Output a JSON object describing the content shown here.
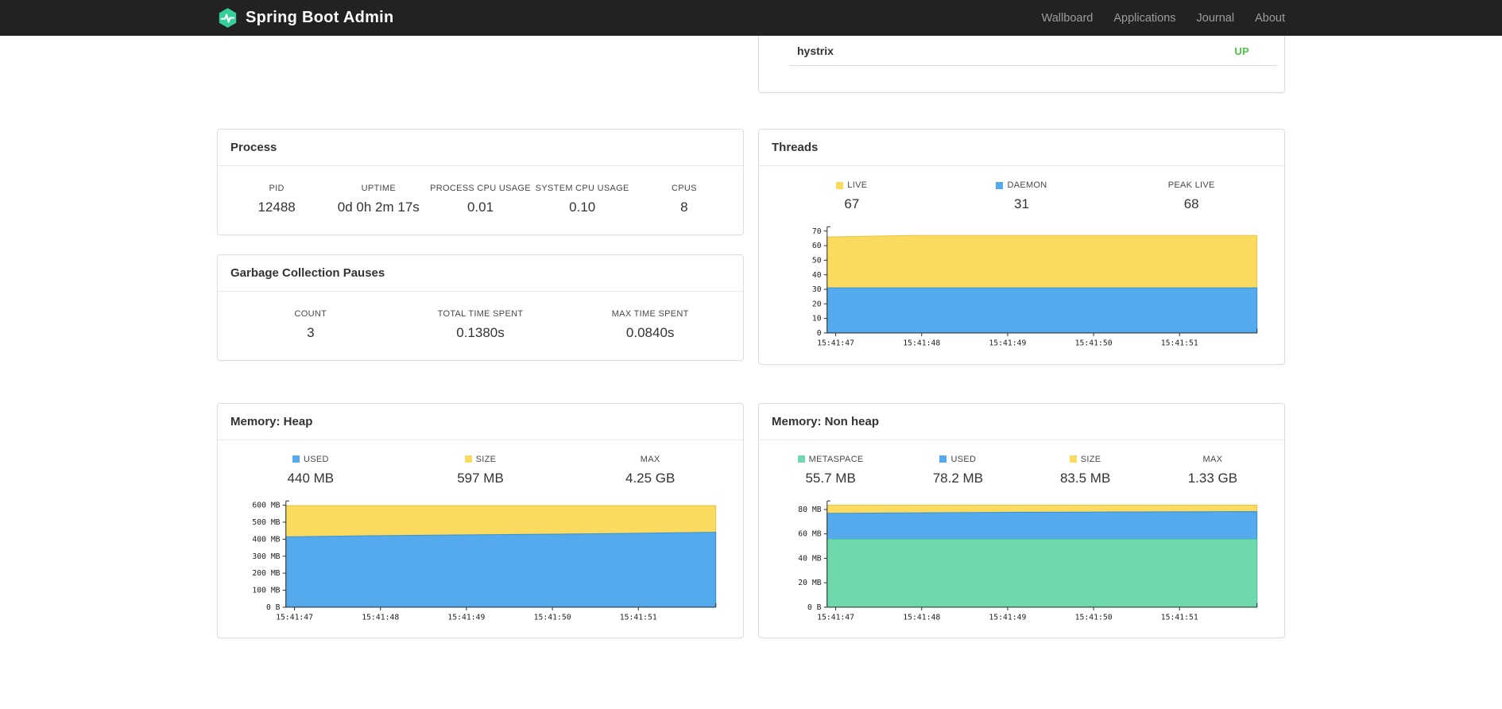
{
  "navbar": {
    "brand": "Spring Boot Admin",
    "items": [
      "Wallboard",
      "Applications",
      "Journal",
      "About"
    ]
  },
  "colors": {
    "navbar_bg": "#222222",
    "logo_green": "#36cf9a",
    "status_up": "#4ec04e",
    "chart_yellow": "#fbda60",
    "chart_blue": "#54aaec",
    "chart_green": "#6fd9ad"
  },
  "application_panel": {
    "row_label": "hystrix",
    "row_status": "UP"
  },
  "panels": {
    "process": {
      "title": "Process",
      "metrics": [
        {
          "label": "PID",
          "value": "12488"
        },
        {
          "label": "UPTIME",
          "value": "0d 0h 2m 17s"
        },
        {
          "label": "PROCESS CPU USAGE",
          "value": "0.01"
        },
        {
          "label": "SYSTEM CPU USAGE",
          "value": "0.10"
        },
        {
          "label": "CPUS",
          "value": "8"
        }
      ]
    },
    "gc": {
      "title": "Garbage Collection Pauses",
      "metrics": [
        {
          "label": "COUNT",
          "value": "3"
        },
        {
          "label": "TOTAL TIME SPENT",
          "value": "0.1380s"
        },
        {
          "label": "MAX TIME SPENT",
          "value": "0.0840s"
        }
      ]
    },
    "threads": {
      "title": "Threads",
      "metrics": [
        {
          "label": "LIVE",
          "value": "67",
          "swatch": "#fbda60"
        },
        {
          "label": "DAEMON",
          "value": "31",
          "swatch": "#54aaec"
        },
        {
          "label": "PEAK LIVE",
          "value": "68"
        }
      ]
    },
    "heap": {
      "title": "Memory: Heap",
      "metrics": [
        {
          "label": "USED",
          "value": "440 MB",
          "swatch": "#54aaec"
        },
        {
          "label": "SIZE",
          "value": "597 MB",
          "swatch": "#fbda60"
        },
        {
          "label": "MAX",
          "value": "4.25 GB"
        }
      ]
    },
    "nonheap": {
      "title": "Memory: Non heap",
      "metrics": [
        {
          "label": "METASPACE",
          "value": "55.7 MB",
          "swatch": "#6fd9ad"
        },
        {
          "label": "USED",
          "value": "78.2 MB",
          "swatch": "#54aaec"
        },
        {
          "label": "SIZE",
          "value": "83.5 MB",
          "swatch": "#fbda60"
        },
        {
          "label": "MAX",
          "value": "1.33 GB"
        }
      ]
    }
  },
  "chart_data": [
    {
      "type": "area",
      "title": "Threads",
      "x": [
        "15:41:47",
        "15:41:48",
        "15:41:49",
        "15:41:50",
        "15:41:51"
      ],
      "ylim": [
        0,
        73
      ],
      "yticks": [
        [
          0,
          "0"
        ],
        [
          10,
          "10"
        ],
        [
          20,
          "20"
        ],
        [
          30,
          "30"
        ],
        [
          40,
          "40"
        ],
        [
          50,
          "50"
        ],
        [
          60,
          "60"
        ],
        [
          70,
          "70"
        ]
      ],
      "series": [
        {
          "name": "LIVE",
          "color": "#fbda60",
          "edge": "#e8c543",
          "values": [
            66,
            67,
            67,
            67,
            67,
            67
          ]
        },
        {
          "name": "DAEMON",
          "color": "#54aaec",
          "edge": "#3792d5",
          "values": [
            31,
            31,
            31,
            31,
            31,
            31
          ]
        }
      ]
    },
    {
      "type": "area",
      "title": "Memory: Heap (MB)",
      "x": [
        "15:41:47",
        "15:41:48",
        "15:41:49",
        "15:41:50",
        "15:41:51"
      ],
      "ylim": [
        0,
        625
      ],
      "yticks": [
        [
          0,
          "0 B"
        ],
        [
          100,
          "100 MB"
        ],
        [
          200,
          "200 MB"
        ],
        [
          300,
          "300 MB"
        ],
        [
          400,
          "400 MB"
        ],
        [
          500,
          "500 MB"
        ],
        [
          600,
          "600 MB"
        ]
      ],
      "series": [
        {
          "name": "SIZE",
          "color": "#fbda60",
          "edge": "#e8c543",
          "values": [
            597,
            597,
            597,
            597,
            597,
            597
          ]
        },
        {
          "name": "USED",
          "color": "#54aaec",
          "edge": "#3792d5",
          "values": [
            414,
            420,
            425,
            429,
            434,
            441
          ]
        }
      ]
    },
    {
      "type": "area",
      "title": "Memory: Non heap (MB)",
      "x": [
        "15:41:47",
        "15:41:48",
        "15:41:49",
        "15:41:50",
        "15:41:51"
      ],
      "ylim": [
        0,
        87
      ],
      "yticks": [
        [
          0,
          "0 B"
        ],
        [
          20,
          "20 MB"
        ],
        [
          40,
          "40 MB"
        ],
        [
          60,
          "60 MB"
        ],
        [
          80,
          "80 MB"
        ]
      ],
      "series": [
        {
          "name": "SIZE",
          "color": "#fbda60",
          "edge": "#e8c543",
          "values": [
            83.5,
            83.5,
            83.5,
            83.5,
            83.5,
            83.5
          ]
        },
        {
          "name": "USED",
          "color": "#54aaec",
          "edge": "#3792d5",
          "values": [
            76.8,
            77.2,
            77.6,
            77.9,
            78.1,
            78.2
          ]
        },
        {
          "name": "METASPACE",
          "color": "#6fd9ad",
          "edge": "#4cc897",
          "values": [
            55.7,
            55.7,
            55.7,
            55.7,
            55.7,
            55.7
          ]
        }
      ]
    }
  ]
}
